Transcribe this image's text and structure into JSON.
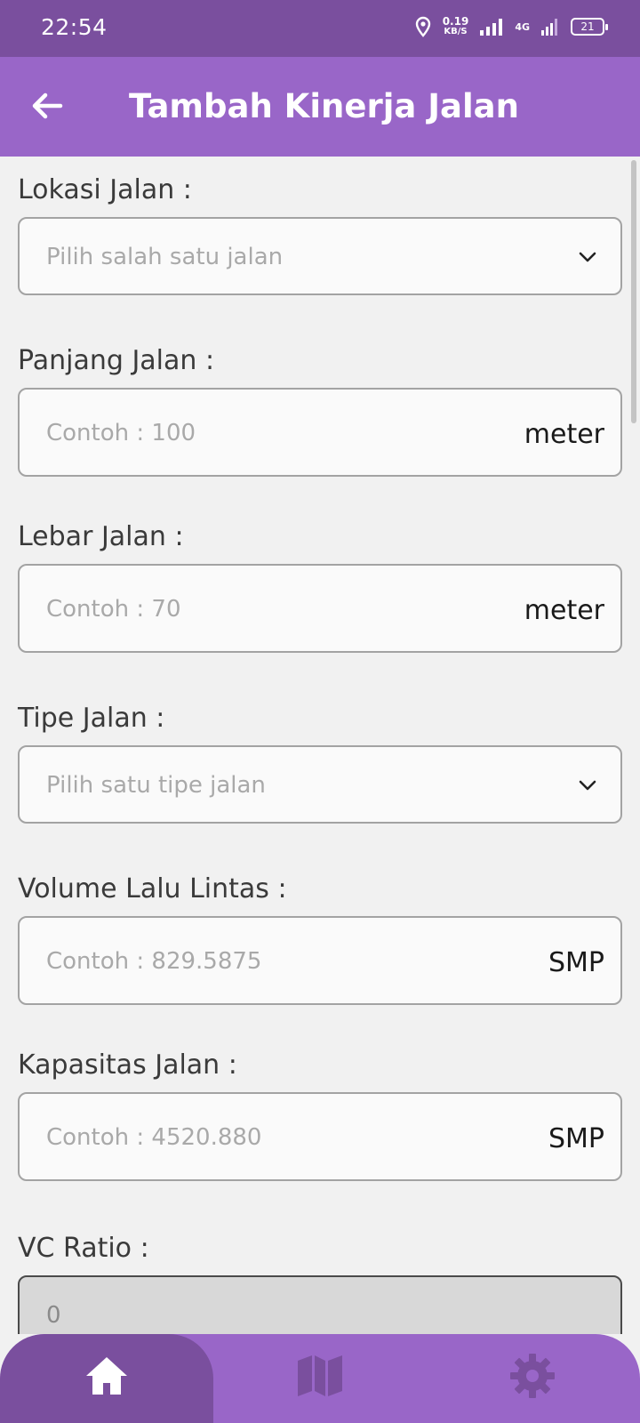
{
  "status_bar": {
    "time": "22:54",
    "net_speed_value": "0.19",
    "net_speed_unit": "KB/S",
    "network_type": "4G",
    "battery_level": "21"
  },
  "app_bar": {
    "title": "Tambah Kinerja Jalan",
    "back_icon": "arrow-left-icon"
  },
  "form": {
    "lokasi": {
      "label": "Lokasi Jalan :",
      "placeholder": "Pilih salah satu jalan"
    },
    "panjang": {
      "label": "Panjang Jalan :",
      "placeholder": "Contoh : 100",
      "unit": "meter"
    },
    "lebar": {
      "label": "Lebar Jalan :",
      "placeholder": "Contoh : 70",
      "unit": "meter"
    },
    "tipe": {
      "label": "Tipe Jalan :",
      "placeholder": "Pilih satu tipe jalan"
    },
    "volume": {
      "label": "Volume Lalu Lintas :",
      "placeholder": "Contoh : 829.5875",
      "unit": "SMP"
    },
    "kapasitas": {
      "label": "Kapasitas Jalan :",
      "placeholder": "Contoh : 4520.880",
      "unit": "SMP"
    },
    "vc_ratio": {
      "label": "VC Ratio :",
      "value": "0"
    }
  },
  "bottom_nav": {
    "items": [
      {
        "icon": "home-icon",
        "active": true
      },
      {
        "icon": "map-icon",
        "active": false
      },
      {
        "icon": "gear-icon",
        "active": false
      }
    ]
  },
  "colors": {
    "status_bar": "#7a4f9e",
    "app_bar": "#9966c8",
    "nav_active": "#7a4f9e",
    "nav_inactive_icon": "#7a4f9e"
  }
}
